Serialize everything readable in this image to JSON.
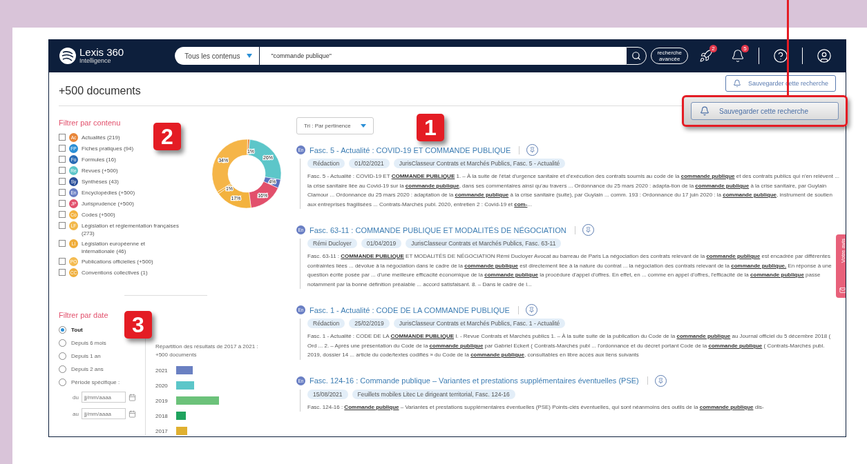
{
  "header": {
    "logo": {
      "name": "Lexis 360",
      "subtitle": "Intelligence"
    },
    "scope": "Tous les contenus",
    "query": "\"commande publique\"",
    "advanced": [
      "recherche",
      "avancée"
    ],
    "badges": [
      {
        "kind": "rocket",
        "count": "2"
      },
      {
        "kind": "bell",
        "count": "5"
      }
    ]
  },
  "results_count": "+500 documents",
  "save_button": "Sauvegarder cette recherche",
  "content_filter": {
    "title": "Filtrer par contenu",
    "items": [
      {
        "abbr": "Ac",
        "label": "Actualités (219)",
        "color": "#e8863a",
        "checked": false
      },
      {
        "abbr": "FP",
        "label": "Fiches pratiques (94)",
        "color": "#2a8fd6",
        "checked": false
      },
      {
        "abbr": "Fo",
        "label": "Formules (16)",
        "color": "#2b6cb5",
        "checked": false
      },
      {
        "abbr": "Re",
        "label": "Revues (+500)",
        "color": "#5cc6c9",
        "checked": false
      },
      {
        "abbr": "Sy",
        "label": "Synthèses (43)",
        "color": "#2a4f9a",
        "checked": false
      },
      {
        "abbr": "En",
        "label": "Encyclopédies (+500)",
        "color": "#6a7fc4",
        "checked": false
      },
      {
        "abbr": "JP",
        "label": "Jurisprudence (+500)",
        "color": "#e2506c",
        "checked": false
      },
      {
        "abbr": "Co",
        "label": "Codes (+500)",
        "color": "#f3b23e",
        "checked": false
      },
      {
        "abbr": "LF",
        "label": "Législation et réglementation françaises (273)",
        "color": "#f2b84a",
        "checked": false
      },
      {
        "abbr": "LI",
        "label": "Législation européenne et internationale (46)",
        "color": "#f0ad3a",
        "checked": false
      },
      {
        "abbr": "PO",
        "label": "Publications officielles (+500)",
        "color": "#f4bb50",
        "checked": false
      },
      {
        "abbr": "CC",
        "label": "Conventions collectives (1)",
        "color": "#efb040",
        "checked": false
      }
    ],
    "chart_data": {
      "type": "donut",
      "values": [
        1,
        26,
        4,
        16,
        17,
        1,
        34
      ],
      "value_labels": [
        "1%",
        "26%",
        "4%",
        "16%",
        "17%",
        "1%",
        "34%"
      ],
      "colors": [
        "#e8863a",
        "#5cc6c9",
        "#5a72c0",
        "#e2506c",
        "#f3b23e",
        "#f3b23e",
        "#f5b548"
      ]
    }
  },
  "date_filter": {
    "title": "Filtrer par date",
    "options": [
      {
        "label": "Tout",
        "selected": true
      },
      {
        "label": "Depuis 6 mois",
        "selected": false
      },
      {
        "label": "Depuis 1 an",
        "selected": false
      },
      {
        "label": "Depuis 2 ans",
        "selected": false
      },
      {
        "label": "Période spécifique :",
        "selected": false
      }
    ],
    "fields": [
      {
        "label": "du",
        "placeholder": "jj/mm/aaaa"
      },
      {
        "label": "au",
        "placeholder": "jj/mm/aaaa"
      }
    ],
    "caption": [
      "Répartition des résultats de 2017 à 2021 :",
      "+500 documents"
    ],
    "years": [
      {
        "year": "2021",
        "color": "#6a80c2"
      },
      {
        "year": "2020",
        "color": "#5cc6c9"
      },
      {
        "year": "2019",
        "color": "#6cc27a"
      },
      {
        "year": "2018",
        "color": "#1fa35e"
      },
      {
        "year": "2017",
        "color": "#e0b030"
      }
    ]
  },
  "sort": "Tri : Par pertinence",
  "results": [
    {
      "badge": "En",
      "title": "Fasc. 5 - Actualité : COVID-19 ET COMMANDE PUBLIQUE",
      "tags": [
        "Rédaction",
        "01/02/2021",
        "JurisClasseur Contrats et Marchés Publics, Fasc. 5 - Actualité"
      ],
      "excerpt": "Fasc. 5 - Actualité : COVID-19 ET **COMMANDE PUBLIQUE** 1. – À la suite de l'état d'urgence sanitaire et d'exécution des contrats soumis au code de la **commande publique** et des contrats publics qui n'en relèvent ... la crise sanitaire liée au Covid-19 sur la **commande publique**, dans ses commentaires ainsi qu'au travers ... Ordonnance du 25 mars 2020 : adapta-tion de la **commande publique** à la crise sanitaire, par Guylain Clamour ... Ordonnance du 25 mars 2020 : adaptation de la **commande publique** à la crise sanitaire (suite), par Guylain ... comm. 193 : Ordonnance du 17 juin 2020  : la **commande publique**, instrument de soutien aux entreprises fragilisées ... Contrats-Marchés publ. 2020, entretien 2 : Covid-19 et **com-**..."
    },
    {
      "badge": "En",
      "title": "Fasc. 63-11 : COMMANDE PUBLIQUE ET MODALITÉS DE NÉGOCIATION",
      "tags": [
        "Rémi Ducloyer",
        "01/04/2019",
        "JurisClasseur Contrats et Marchés Publics, Fasc. 63-11"
      ],
      "excerpt": "Fasc. 63-11 : **COMMANDE PUBLIQUE** ET MODALITÉS DE NÉGOCIATION Rémi Ducloyer Avocat au barreau de Paris La négociation des contrats relevant de la **commande publique** est encadrée par différentes contraintes liées ... dévolue à la négociation dans le cadre de la **commande publique** est directement liée à la nature du contrat ... la négociation des contrats relevant de la **commande publique.** En réponse à une question écrite posée par ... d'une meilleure efficacité économique de la **commande publique** la procédure d'appel d'offres. En effet, en ... comme en appel d'offres, l'efficacité de la **commande publique** passe notamment par la bonne définition préalable ... accord satisfaisant. 8. – Dans le cadre de l..."
    },
    {
      "badge": "En",
      "title": "Fasc. 1 - Actualité : CODE DE LA COMMANDE PUBLIQUE",
      "tags": [
        "Rédaction",
        "25/02/2019",
        "JurisClasseur Contrats et Marchés Publics, Fasc. 1 - Actualité"
      ],
      "excerpt": "Fasc. 1 - Actualité : CODE DE LA **COMMANDE PUBLIQUE** I. - Revue Contrats et Marchés publics 1. – À la suite suite de la publication du Code de la **commande publique** au Journal officiel du 5 décembre 2018 ( Ord ... 2. – Après une présentation du Code de la **commande publique** par Gabriel Eckert ( Contrats-Marchés publ ... l'ordonnance et du décret portant Code de la **commande publique** ( Contrats-Marchés publ. 2019, dossier 14 ... article du code/textes codifiés » du Code de la **commande publique**, consultables en libre accès aux liens suivants"
    },
    {
      "badge": "En",
      "title": "Fasc. 124-16 : Commande publique – Variantes et prestations supplémentaires éventuelles (PSE)",
      "tags": [
        "15/08/2021",
        "Feuillets mobiles Litec Le dirigeant territorial, Fasc. 124-16"
      ],
      "excerpt": "Fasc. 124-16 : **Commande publique** – Variantes et prestations supplémentaires éventuelles (PSE) Points-clés éventuelles, qui sont néanmoins des outils de la **commande publique** dis-"
    }
  ],
  "feedback_tab": "Votre avis",
  "annotations": [
    "1",
    "2",
    "3"
  ],
  "callout": {
    "label": "Sauvegarder cette recherche"
  }
}
